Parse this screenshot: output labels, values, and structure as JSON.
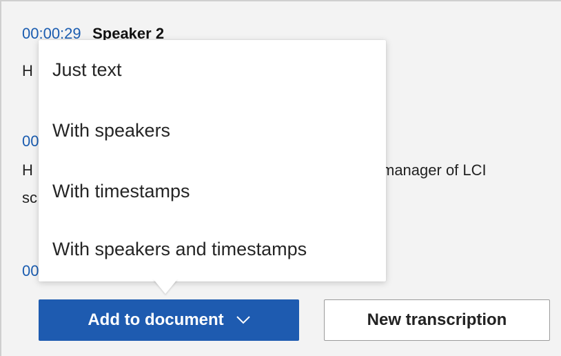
{
  "transcript": {
    "entry1": {
      "timestamp": "00:00:29",
      "speaker": "Speaker 2",
      "text_start": "H"
    },
    "entry2": {
      "timestamp_start": "00",
      "text_line1_start": "H",
      "text_line1_end": "manager of LCI",
      "text_line2_start": "sc"
    },
    "entry3": {
      "timestamp_start": "00"
    }
  },
  "add_menu": {
    "items": [
      {
        "label": "Just text"
      },
      {
        "label": "With speakers"
      },
      {
        "label": "With timestamps"
      },
      {
        "label": "With speakers and timestamps"
      }
    ]
  },
  "buttons": {
    "add_to_document": "Add to document",
    "new_transcription": "New transcription"
  },
  "colors": {
    "primary": "#1e5bb0",
    "timestamp": "#1a5cb0",
    "panel_bg": "#f3f3f3"
  },
  "icons": {
    "dropdown": "chevron-down-icon"
  }
}
